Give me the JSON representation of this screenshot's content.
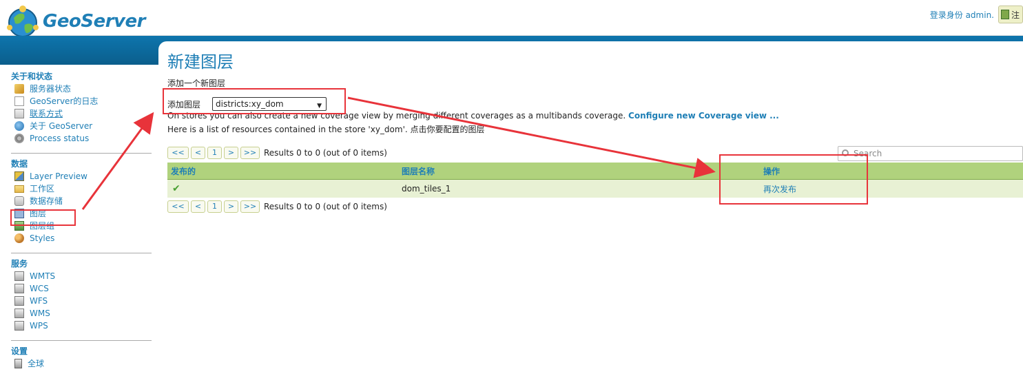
{
  "header": {
    "logo_text": "GeoServer",
    "login_text": "登录身份 admin.",
    "logout_label": "注"
  },
  "sidebar": {
    "sections": [
      {
        "title": "关于和状态",
        "items": [
          {
            "label": "服务器状态",
            "icon": "server-status-icon"
          },
          {
            "label": "GeoServer的日志",
            "icon": "log-icon"
          },
          {
            "label": "联系方式",
            "icon": "contact-icon"
          },
          {
            "label": "关于 GeoServer",
            "icon": "about-icon"
          },
          {
            "label": "Process status",
            "icon": "gear-icon"
          }
        ]
      },
      {
        "title": "数据",
        "items": [
          {
            "label": "Layer Preview",
            "icon": "layer-preview-icon"
          },
          {
            "label": "工作区",
            "icon": "folder-icon"
          },
          {
            "label": "数据存储",
            "icon": "database-icon"
          },
          {
            "label": "图层",
            "icon": "layer-icon"
          },
          {
            "label": "图层组",
            "icon": "layer-group-icon"
          },
          {
            "label": "Styles",
            "icon": "styles-icon"
          }
        ]
      },
      {
        "title": "服务",
        "items": [
          {
            "label": "WMTS",
            "icon": "service-icon"
          },
          {
            "label": "WCS",
            "icon": "service-icon"
          },
          {
            "label": "WFS",
            "icon": "service-icon"
          },
          {
            "label": "WMS",
            "icon": "service-icon"
          },
          {
            "label": "WPS",
            "icon": "service-icon"
          }
        ]
      },
      {
        "title": "设置",
        "items": [
          {
            "label": "全球",
            "icon": "server-icon"
          }
        ]
      }
    ]
  },
  "main": {
    "title": "新建图层",
    "subtitle": "添加一个新图层",
    "add_layer_label": "添加图层",
    "add_layer_value": "districts:xy_dom",
    "coverage_text": "On stores you can also create a new coverage view by merging different coverages as a multibands coverage.",
    "coverage_link": "Configure new Coverage view ...",
    "resources_text": "Here is a list of resources contained in the store 'xy_dom'. 点击你要配置的图层",
    "pager": {
      "first": "<<",
      "prev": "<",
      "page": "1",
      "next": ">",
      "last": ">>",
      "results": "Results 0 to 0 (out of 0 items)"
    },
    "search_placeholder": "Search",
    "table": {
      "headers": [
        "发布的",
        "图层名称",
        "操作"
      ],
      "rows": [
        {
          "published": "✔",
          "name": "dom_tiles_1",
          "action": "再次发布"
        }
      ]
    }
  },
  "colors": {
    "brand_blue": "#1f7fb6",
    "table_header": "#b0d27d",
    "table_row": "#e8f1d4",
    "annotation_red": "#e8333a"
  }
}
